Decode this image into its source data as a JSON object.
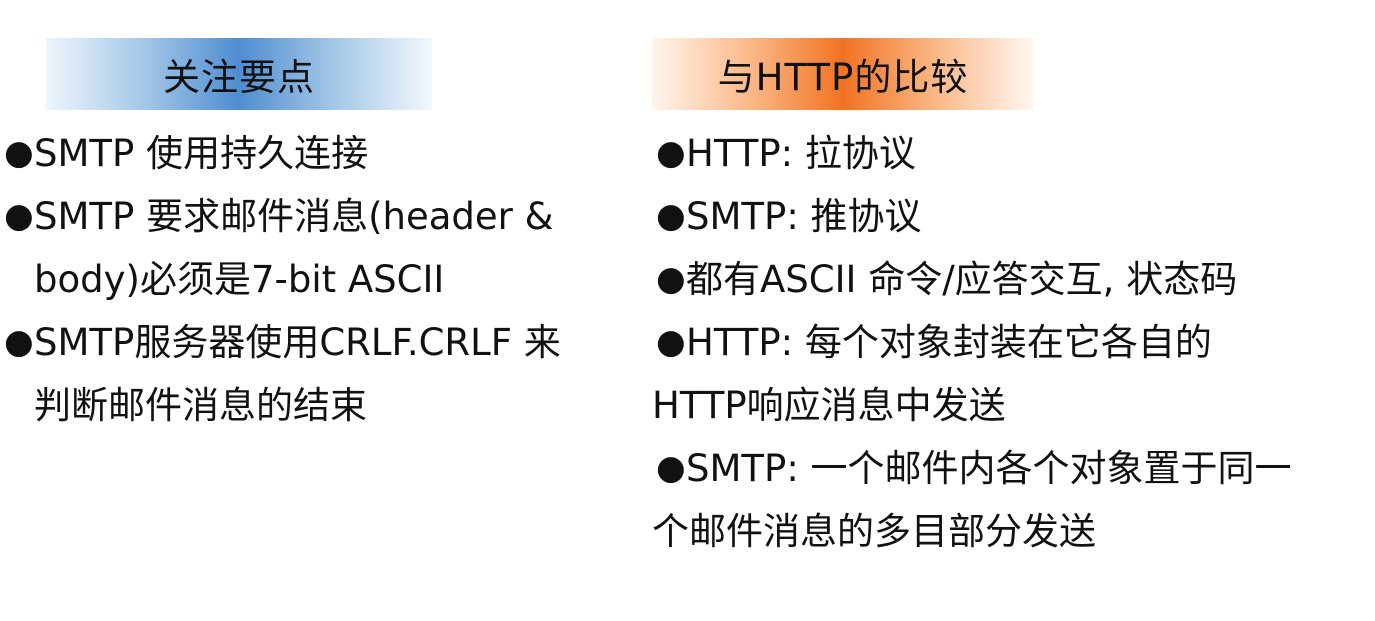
{
  "left": {
    "header": "关注要点",
    "bullet_glyph": "●",
    "items": [
      {
        "line1": "SMTP 使用持久连接",
        "line2": ""
      },
      {
        "line1": "SMTP 要求邮件消息(header &",
        "line2": "body)必须是7-bit ASCII"
      },
      {
        "line1": "SMTP服务器使用CRLF.CRLF 来",
        "line2": "判断邮件消息的结束"
      }
    ]
  },
  "right": {
    "header": "与HTTP的比较",
    "bullet_glyph": "●",
    "items": [
      {
        "line1": "HTTP: 拉协议",
        "line2": ""
      },
      {
        "line1": "SMTP: 推协议",
        "line2": ""
      },
      {
        "line1": "都有ASCII 命令/应答交互, 状态码",
        "line2": ""
      },
      {
        "line1": "HTTP: 每个对象封装在它各自的",
        "line2": "HTTP响应消息中发送"
      },
      {
        "line1": "SMTP: 一个邮件内各个对象置于同一",
        "line2": "个邮件消息的多目部分发送"
      }
    ]
  },
  "colors": {
    "left_header_accent": "#4a8fd4",
    "right_header_accent": "#f07a22",
    "text": "#111111"
  }
}
